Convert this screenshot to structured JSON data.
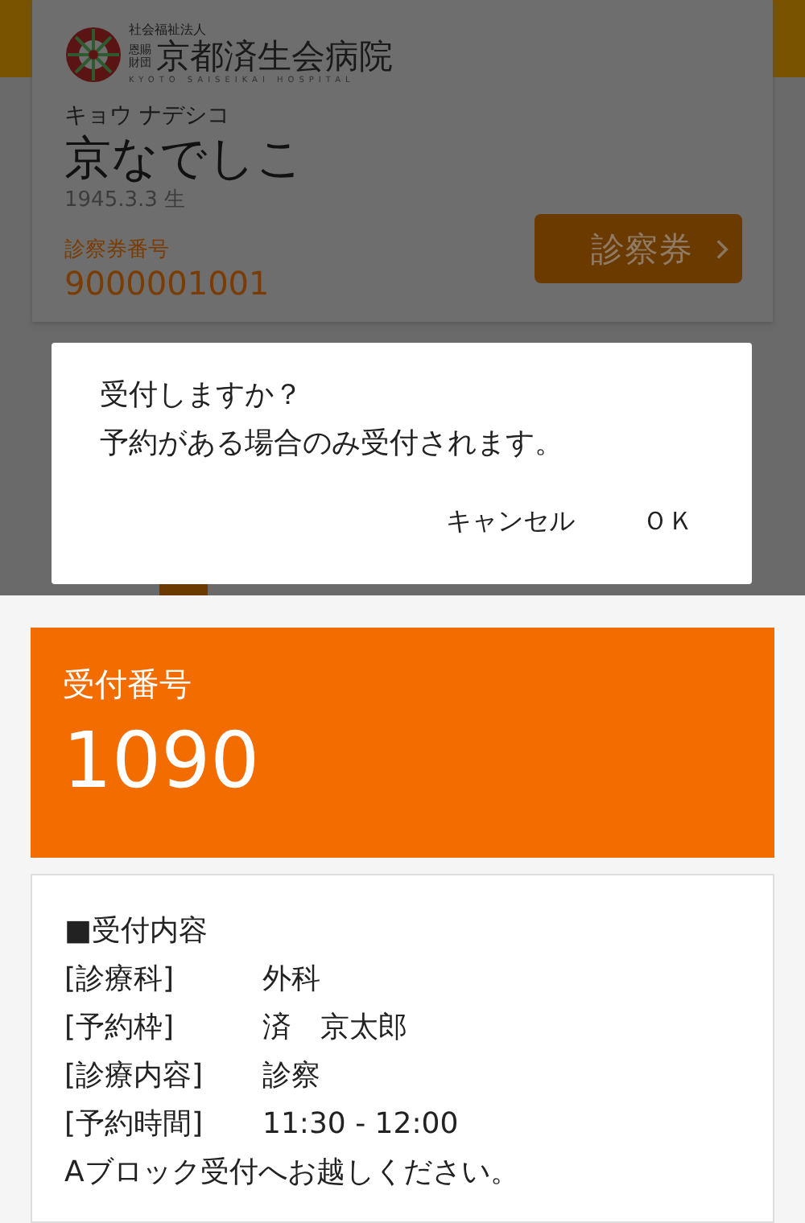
{
  "card_screen": {
    "logo": {
      "corporation": "社会福祉法人",
      "foundation_top": "恩賜",
      "foundation_bottom": "財団",
      "name": "京都済生会病院",
      "english": "KYOTO SAISEIKAI HOSPITAL"
    },
    "patient": {
      "kana": "キョウ ナデシコ",
      "name": "京なでしこ",
      "birth": "1945.3.3 生",
      "card_label": "診察券番号",
      "card_number": "9000001001"
    },
    "card_button": {
      "label": "診察券"
    }
  },
  "dialog": {
    "message_lines": [
      "受付しますか？",
      "予約がある場合のみ受付されます。"
    ],
    "buttons": [
      "キャンセル",
      "ＯＫ"
    ]
  },
  "receipt": {
    "number_label": "受付番号",
    "number": "1090",
    "heading": "■受付内容",
    "rows": [
      {
        "label": "[診療科]",
        "value": "外科"
      },
      {
        "label": "[予約枠]",
        "value": "済　京太郎"
      },
      {
        "label": "[診療内容]",
        "value": "診察"
      },
      {
        "label": "[予約時間]",
        "value": "11:30 - 12:00"
      }
    ],
    "note": "Aブロック受付へお越しください。"
  }
}
